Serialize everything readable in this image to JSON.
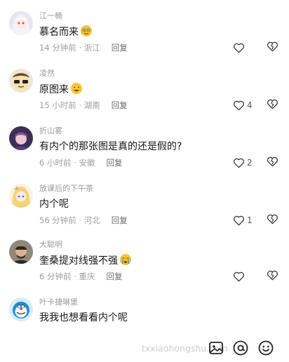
{
  "comments": [
    {
      "username": "江一楠",
      "text": "慕名而来",
      "time": "14 分钟前",
      "location": "浙江",
      "reply": "回复",
      "likes": ""
    },
    {
      "username": "凌然",
      "text": "原图来",
      "time": "15 小时前",
      "location": "湖南",
      "reply": "回复",
      "likes": "4"
    },
    {
      "username": "折山雾",
      "text": "有内个的那张图是真的还是假的?",
      "time": "6 小时前",
      "location": "安徽",
      "reply": "回复",
      "likes": "2"
    },
    {
      "username": "放课后的下午茶",
      "text": "内个呢",
      "time": "56 分钟前",
      "location": "河北",
      "reply": "回复",
      "likes": "1"
    },
    {
      "username": "大聪明",
      "text": "奎桑提对线强不强",
      "time": "6 分钟前",
      "location": "重庆",
      "reply": "回复",
      "likes": ""
    },
    {
      "username": "叶卡捷琳堡",
      "text": "我我也想看看内个呢"
    }
  ],
  "icons": {
    "like": "heart-icon",
    "dislike": "broken-heart-icon",
    "image": "image-icon",
    "at": "at-icon",
    "emoji": "smiley-icon"
  },
  "watermark": "txxiaohongshu.com",
  "colors": {
    "text": "#161616",
    "meta": "#9e9e9e",
    "icon": "#333333"
  }
}
